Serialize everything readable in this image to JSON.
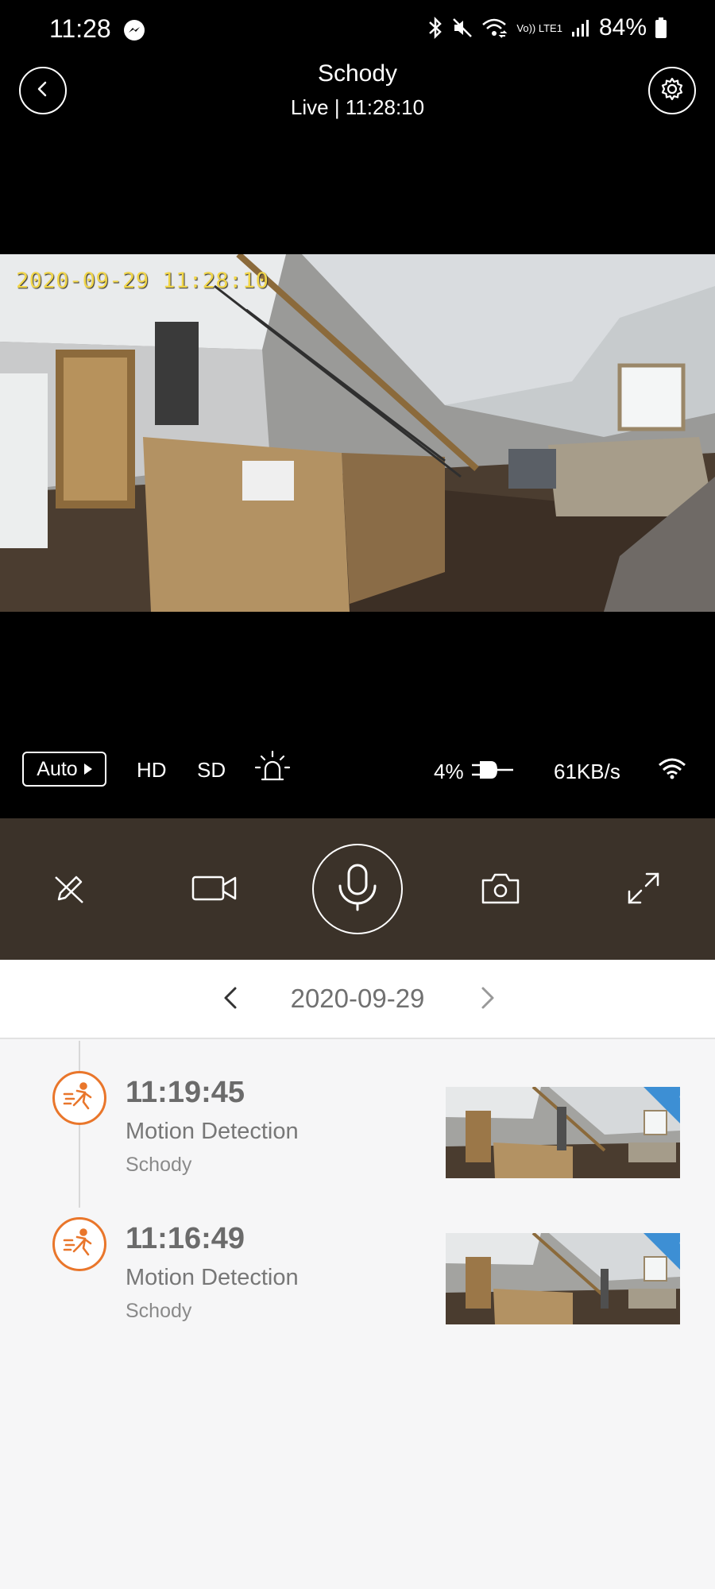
{
  "status_bar": {
    "time": "11:28",
    "volte": "Vo)) LTE1",
    "battery": "84%"
  },
  "header": {
    "title": "Schody",
    "subtitle": "Live | 11:28:10"
  },
  "video": {
    "timestamp_overlay": "2020-09-29 11:28:10"
  },
  "stream_controls": {
    "auto_label": "Auto",
    "hd_label": "HD",
    "sd_label": "SD",
    "battery_level": "4%",
    "speed": "61KB/s"
  },
  "date_nav": {
    "date": "2020-09-29"
  },
  "events": [
    {
      "time": "11:19:45",
      "type": "Motion Detection",
      "camera": "Schody"
    },
    {
      "time": "11:16:49",
      "type": "Motion Detection",
      "camera": "Schody"
    }
  ],
  "colors": {
    "accent": "#e9762b",
    "action_bar": "#3b3229",
    "cloud_badge": "#3d8fd4",
    "timestamp_overlay": "#f1d64a"
  },
  "icons": [
    "messenger-icon",
    "bluetooth-icon",
    "mute-icon",
    "wifi-calling-icon",
    "signal-icon",
    "battery-icon",
    "back-icon",
    "gear-icon",
    "alarm-siren-icon",
    "plug-icon",
    "wifi-icon",
    "edit-off-icon",
    "video-record-icon",
    "microphone-icon",
    "camera-icon",
    "fullscreen-icon",
    "chevron-left-icon",
    "chevron-right-icon",
    "running-person-icon",
    "cloud-icon"
  ]
}
